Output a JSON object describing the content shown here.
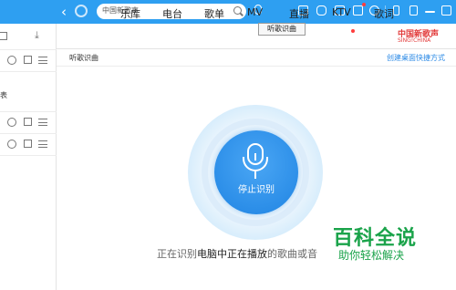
{
  "search": {
    "value": "中国新歌声"
  },
  "tooltip": "听歌识曲",
  "nav": [
    "乐库",
    "电台",
    "歌单",
    "MV",
    "直播",
    "KTV",
    "歌词"
  ],
  "logo": {
    "line1": "中国新歌声",
    "line2": "SING!CHINA"
  },
  "subbar": {
    "title": "听歌识曲",
    "link": "创建桌面快捷方式"
  },
  "sidebar": {
    "row_text": "表"
  },
  "recognize": {
    "button": "停止识别",
    "status_prefix": "正在识别",
    "status_bold": "电脑中正在播放",
    "status_suffix": "的歌曲或音"
  },
  "watermark": {
    "title": "百科全说",
    "subtitle": "助你轻松解决"
  },
  "colors": {
    "topbar": "#2e9ff1",
    "accent": "#1f84e3",
    "watermark": "#1aa34a"
  }
}
